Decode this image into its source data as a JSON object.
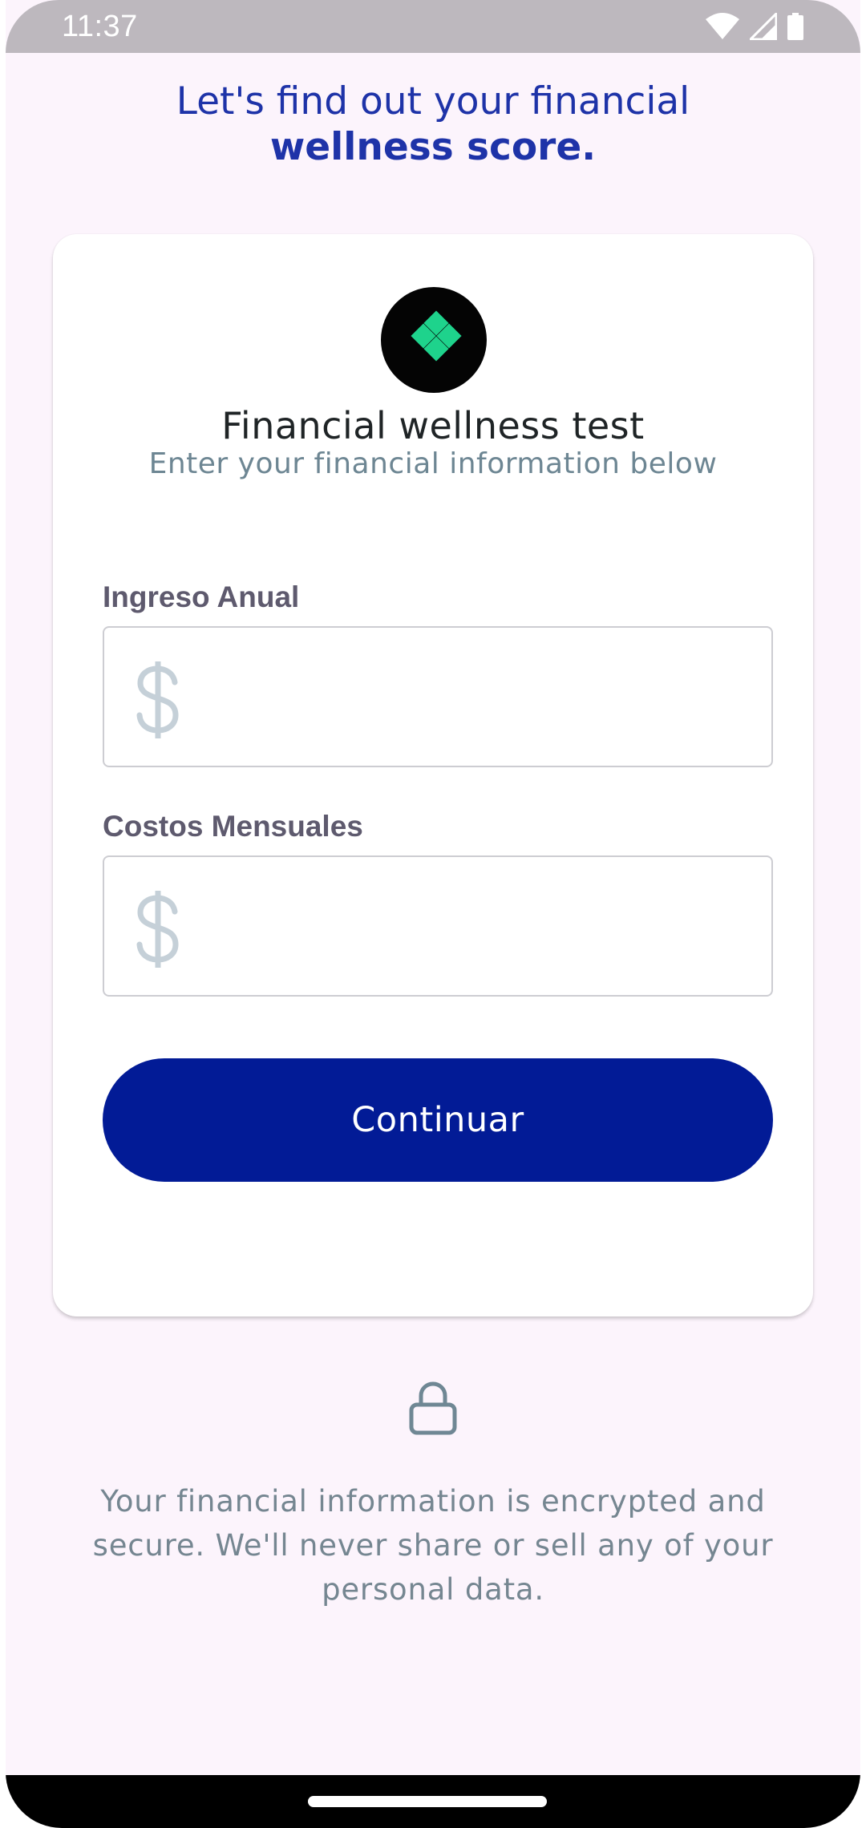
{
  "status_bar": {
    "time": "11:37",
    "icons": [
      "wifi-icon",
      "cellular-signal-icon",
      "battery-icon"
    ]
  },
  "heading": {
    "line1": "Let's find out your financial",
    "line2": "wellness score."
  },
  "card": {
    "logo_icon": "diamond-grid-logo-icon",
    "title": "Financial wellness test",
    "subtitle": "Enter your financial information below",
    "fields": [
      {
        "label": "Ingreso Anual",
        "value": "",
        "prefix_icon": "dollar-icon"
      },
      {
        "label": "Costos Mensuales",
        "value": "",
        "prefix_icon": "dollar-icon"
      }
    ],
    "continue_label": "Continuar"
  },
  "footer": {
    "lock_icon": "lock-icon",
    "security_note": "Your financial information is encrypted and secure. We'll never share or sell any of your personal data."
  },
  "colors": {
    "primary": "#021b96",
    "heading": "#1e33a8",
    "logo_accent": "#1ed38c",
    "background": "#fcf4fc"
  }
}
